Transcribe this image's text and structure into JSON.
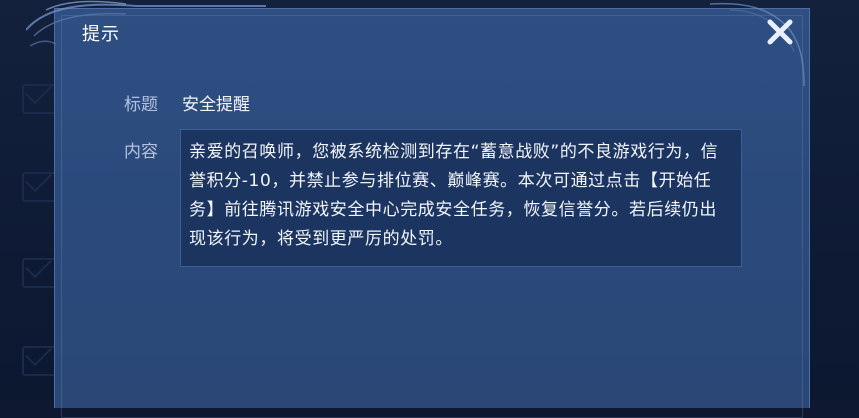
{
  "dialog": {
    "title": "提示",
    "close_icon": "close-icon",
    "close_color": "#e8f0ff"
  },
  "message": {
    "title_label": "标题",
    "title_value": "安全提醒",
    "content_label": "内容",
    "content_value": "亲爱的召唤师，您被系统检测到存在“蓄意战败”的不良游戏行为，信誉积分-10，并禁止参与排位赛、巅峰赛。本次可通过点击【开始任务】前往腾讯游戏安全中心完成安全任务，恢复信誉分。若后续仍出现该行为，将受到更严厉的处罚。"
  },
  "background": {
    "icons": [
      "mail-icon",
      "mail-icon",
      "mail-icon",
      "mail-icon",
      "mail-icon"
    ]
  }
}
